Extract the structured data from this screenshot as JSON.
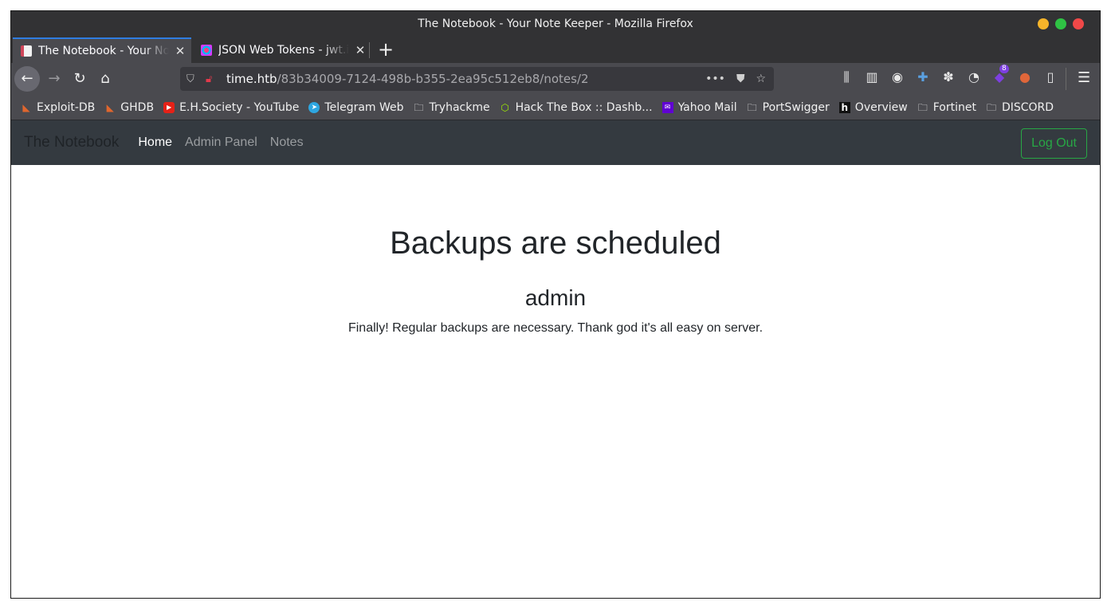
{
  "window": {
    "title": "The Notebook - Your Note Keeper - Mozilla Firefox"
  },
  "tabs": [
    {
      "label": "The Notebook - Your Note Keeper",
      "active": true
    },
    {
      "label": "JSON Web Tokens - jwt.io",
      "active": false
    }
  ],
  "toolbar": {
    "url_host": "time.htb",
    "url_path": "/83b34009-7124-498b-b355-2ea95c512eb8/notes/2",
    "extension_badge": "8"
  },
  "bookmarks": [
    {
      "label": "Exploit-DB",
      "icon": "exploitdb-icon"
    },
    {
      "label": "GHDB",
      "icon": "ghdb-icon"
    },
    {
      "label": "E.H.Society - YouTube",
      "icon": "youtube-icon"
    },
    {
      "label": "Telegram Web",
      "icon": "telegram-icon"
    },
    {
      "label": "Tryhackme",
      "icon": "folder-icon"
    },
    {
      "label": "Hack The Box :: Dashb...",
      "icon": "htb-icon"
    },
    {
      "label": "Yahoo Mail",
      "icon": "yahoo-mail-icon"
    },
    {
      "label": "PortSwigger",
      "icon": "folder-icon"
    },
    {
      "label": "Overview",
      "icon": "overview-icon"
    },
    {
      "label": "Fortinet",
      "icon": "folder-icon"
    },
    {
      "label": "DISCORD",
      "icon": "folder-icon"
    }
  ],
  "site_nav": {
    "brand": "The Notebook",
    "links": [
      "Home",
      "Admin Panel",
      "Notes"
    ],
    "logout": "Log Out"
  },
  "note": {
    "title": "Backups are scheduled",
    "author": "admin",
    "body": "Finally! Regular backups are necessary. Thank god it's all easy on server."
  },
  "colors": {
    "accent_tab": "#2f7de1",
    "logout_green": "#28a745",
    "site_navbar": "#343a40"
  }
}
